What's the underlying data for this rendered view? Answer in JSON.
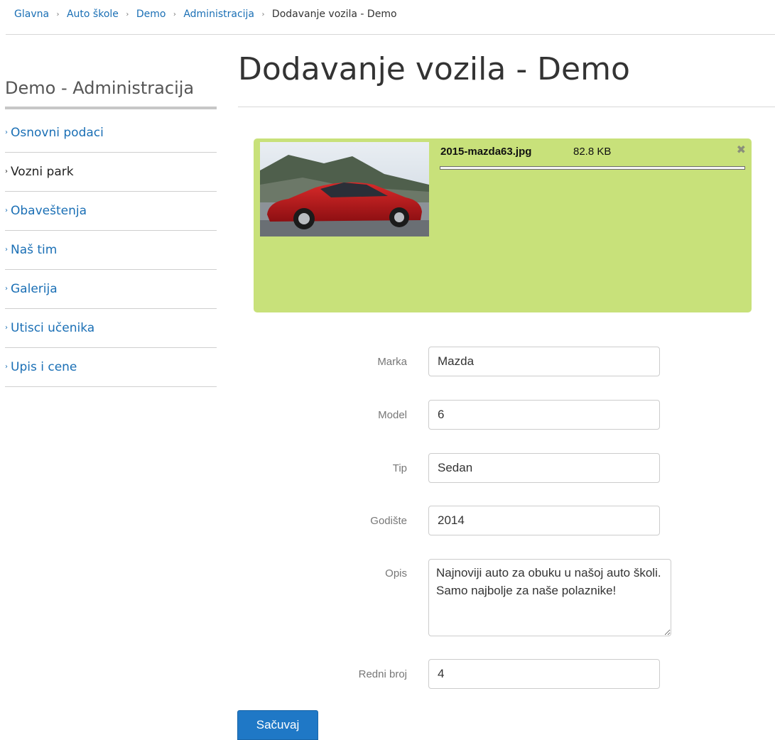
{
  "breadcrumb": {
    "items": [
      "Glavna",
      "Auto škole",
      "Demo",
      "Administracija"
    ],
    "current": "Dodavanje vozila - Demo"
  },
  "sidebar": {
    "title": "Demo - Administracija",
    "items": [
      {
        "label": "Osnovni podaci",
        "active": false
      },
      {
        "label": "Vozni park",
        "active": true
      },
      {
        "label": "Obaveštenja",
        "active": false
      },
      {
        "label": "Naš tim",
        "active": false
      },
      {
        "label": "Galerija",
        "active": false
      },
      {
        "label": "Utisci učenika",
        "active": false
      },
      {
        "label": "Upis i cene",
        "active": false
      }
    ]
  },
  "page": {
    "title": "Dodavanje vozila - Demo"
  },
  "upload": {
    "file_name": "2015-mazda63.jpg",
    "file_size": "82.8 KB",
    "progress": 1.0,
    "remove_label": "✖",
    "bg_color": "#c8e17a"
  },
  "form": {
    "marka": {
      "label": "Marka",
      "value": "Mazda"
    },
    "model": {
      "label": "Model",
      "value": "6"
    },
    "tip": {
      "label": "Tip",
      "value": "Sedan"
    },
    "godiste": {
      "label": "Godište",
      "value": "2014"
    },
    "opis": {
      "label": "Opis",
      "value": "Najnoviji auto za obuku u našoj auto školi. Samo najbolje za naše polaznike!"
    },
    "redni_broj": {
      "label": "Redni broj",
      "value": "4"
    },
    "save_label": "Sačuvaj"
  },
  "colors": {
    "link": "#1a6fb5",
    "button": "#1f78c6"
  }
}
